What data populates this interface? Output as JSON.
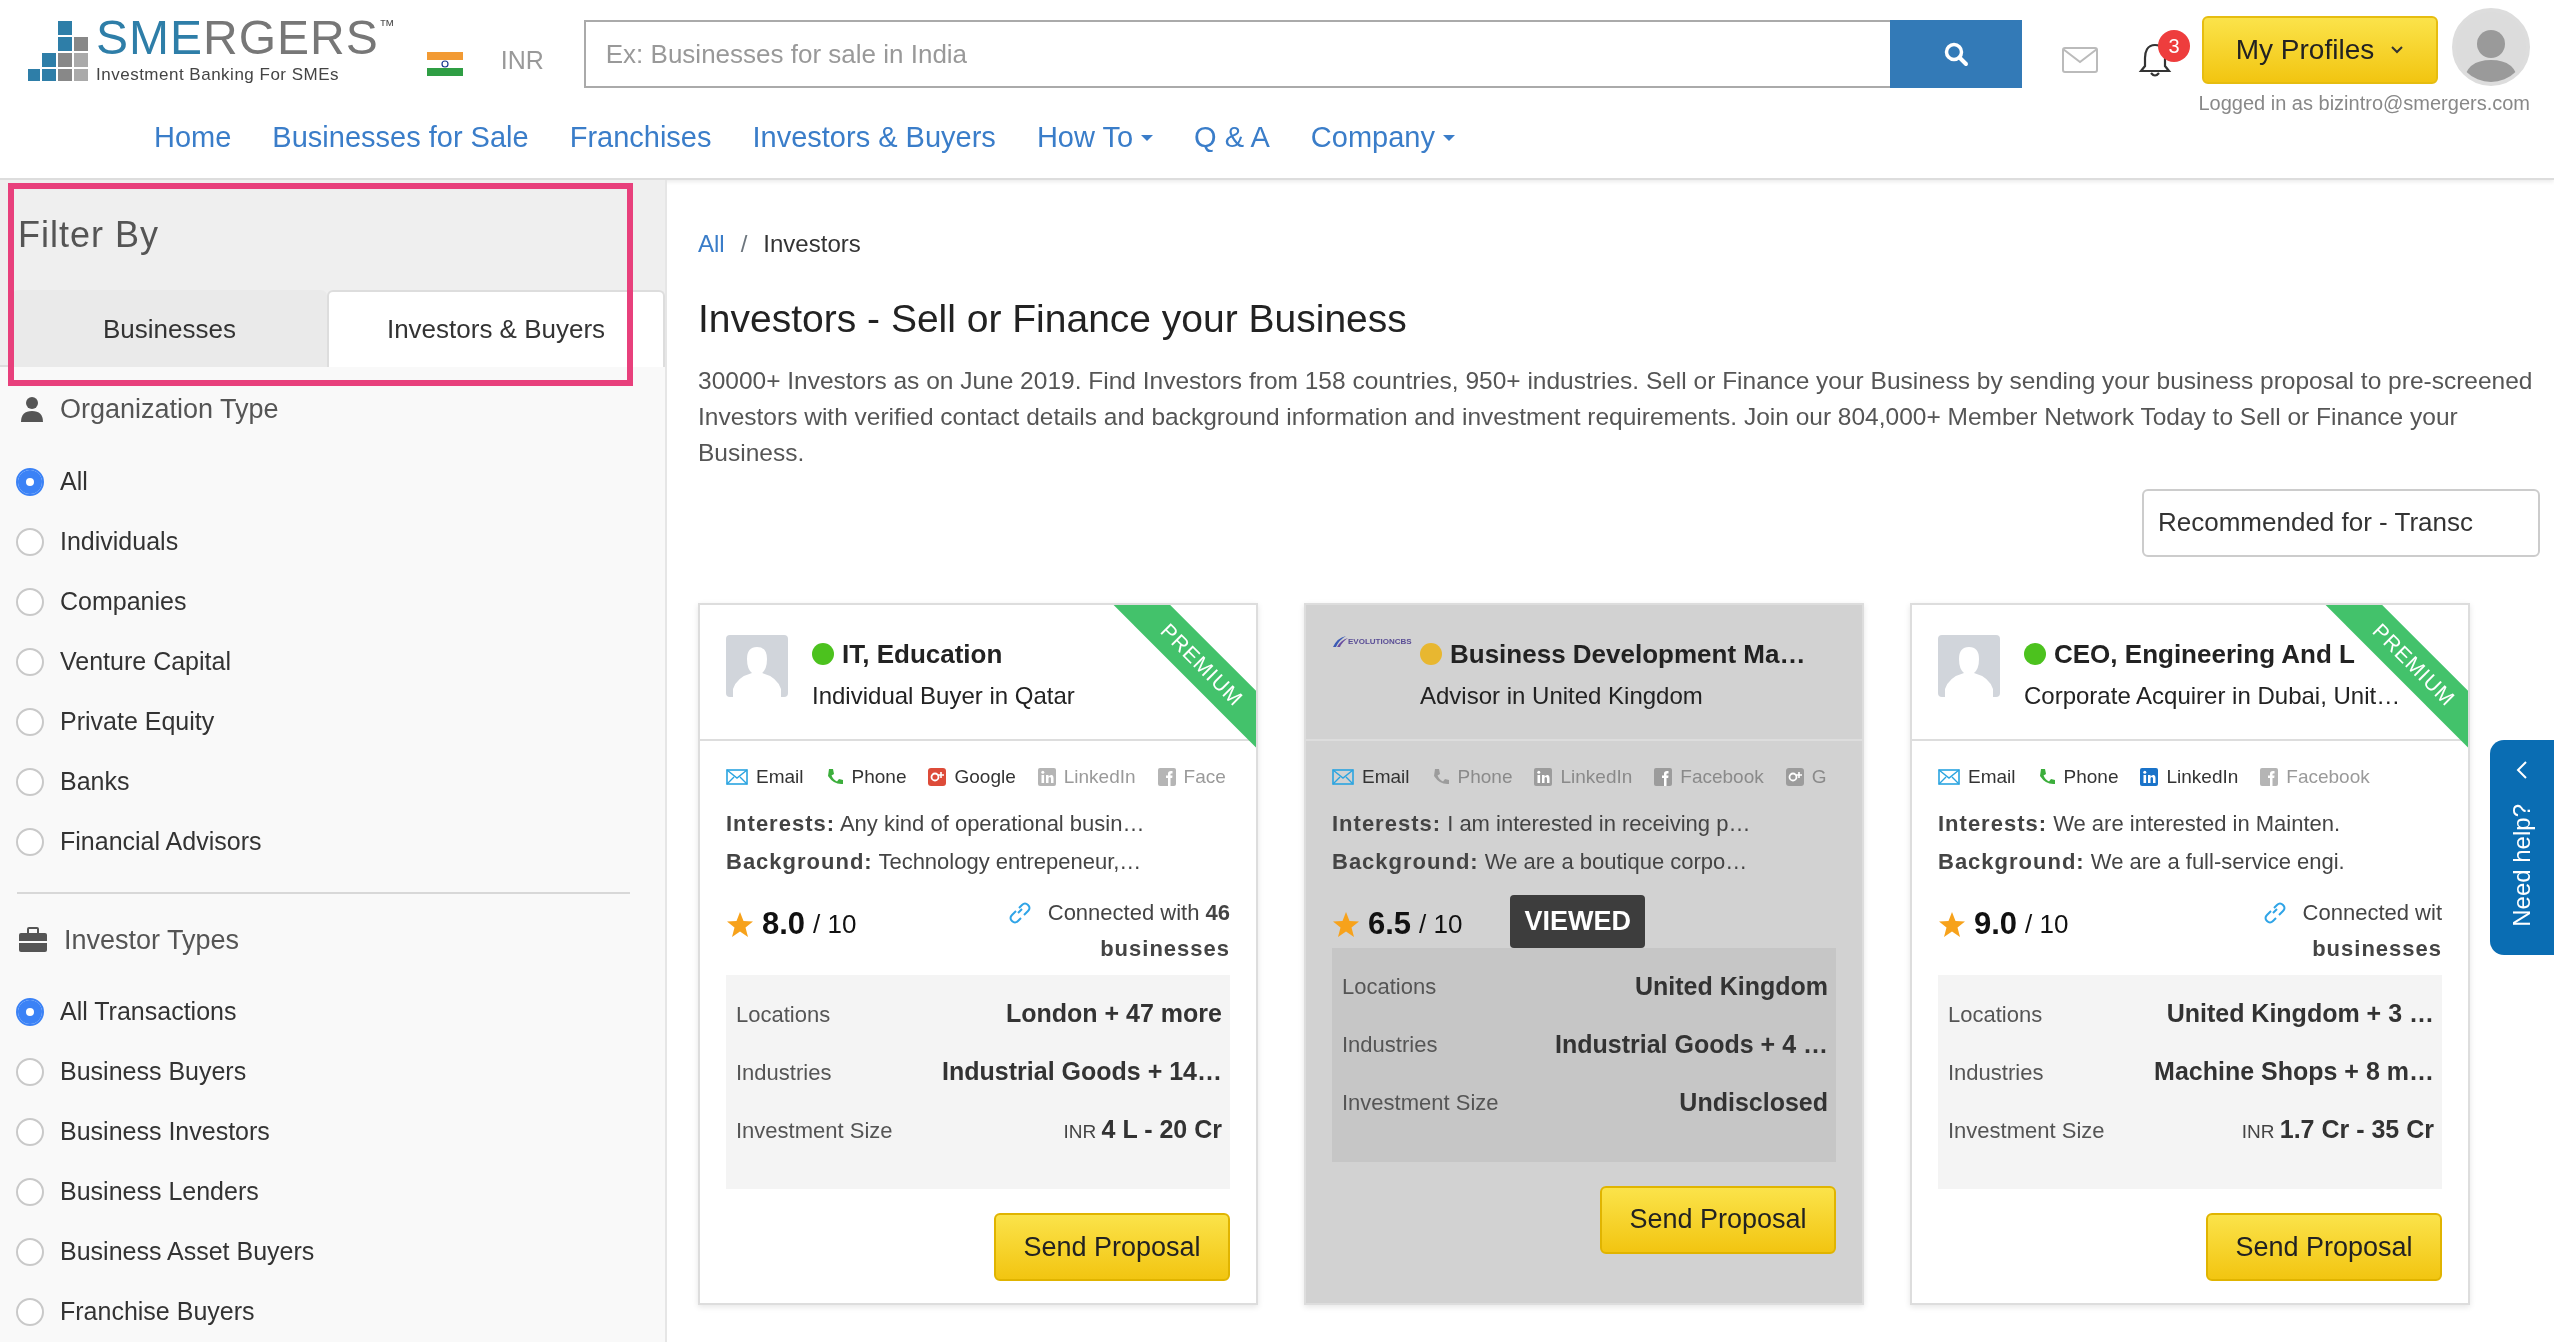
{
  "header": {
    "logo_primary": "SME",
    "logo_secondary": "RGERS",
    "logo_tm": "™",
    "logo_tagline": "Investment Banking For SMEs",
    "currency": "INR",
    "search": {
      "placeholder": "Ex: Businesses for sale in India"
    },
    "notifications": "3",
    "profile_button": "My Profiles",
    "logged_in": "Logged in as bizintro@smergers.com"
  },
  "nav": [
    {
      "label": "Home",
      "dropdown": false
    },
    {
      "label": "Businesses for Sale",
      "dropdown": false
    },
    {
      "label": "Franchises",
      "dropdown": false
    },
    {
      "label": "Investors & Buyers",
      "dropdown": false
    },
    {
      "label": "How To",
      "dropdown": true
    },
    {
      "label": "Q & A",
      "dropdown": false
    },
    {
      "label": "Company",
      "dropdown": true
    }
  ],
  "sidebar": {
    "title": "Filter By",
    "tabs": [
      {
        "label": "Businesses",
        "selected": false
      },
      {
        "label": "Investors & Buyers",
        "selected": true
      }
    ],
    "groups": [
      {
        "kind": "person",
        "title": "Organization Type",
        "options": [
          {
            "label": "All",
            "selected": true
          },
          {
            "label": "Individuals",
            "selected": false
          },
          {
            "label": "Companies",
            "selected": false
          },
          {
            "label": "Venture Capital",
            "selected": false
          },
          {
            "label": "Private Equity",
            "selected": false
          },
          {
            "label": "Banks",
            "selected": false
          },
          {
            "label": "Financial Advisors",
            "selected": false
          }
        ]
      },
      {
        "kind": "briefcase",
        "title": "Investor Types",
        "options": [
          {
            "label": "All Transactions",
            "selected": true
          },
          {
            "label": "Business Buyers",
            "selected": false
          },
          {
            "label": "Business Investors",
            "selected": false
          },
          {
            "label": "Business Lenders",
            "selected": false
          },
          {
            "label": "Business Asset Buyers",
            "selected": false
          },
          {
            "label": "Franchise Buyers",
            "selected": false
          }
        ]
      }
    ]
  },
  "breadcrumb": {
    "items": [
      {
        "label": "All",
        "link": true
      },
      {
        "label": "Investors",
        "link": false
      }
    ],
    "separator": "/"
  },
  "title": "Investors - Sell or Finance your Business",
  "description": "30000+ Investors as on June 2019. Find Investors from 158 countries, 950+ industries. Sell or Finance your Business by sending your business proposal to pre-screened Investors with verified contact details and background information and investment requirements. Join our 804,000+ Member Network Today to Sell or Finance your Business.",
  "sort": "Recommended for - Transc",
  "cards": [
    {
      "premium": true,
      "premium_label": "PREMIUM",
      "viewed": false,
      "kind": "person",
      "color": "#4cc21e",
      "title": "IT, Education",
      "subtitle": "Individual Buyer in Qatar",
      "contacts": [
        {
          "kind": "email",
          "label": "Email",
          "enabled": true
        },
        {
          "kind": "phone",
          "label": "Phone",
          "enabled": true
        },
        {
          "kind": "google",
          "label": "Google",
          "enabled": true
        },
        {
          "kind": "linkedin",
          "label": "LinkedIn",
          "enabled": false
        },
        {
          "kind": "facebook",
          "label": "Face",
          "enabled": false
        }
      ],
      "interests_label": "Interests:",
      "interests": "Any kind of operational busin…",
      "background_label": "Background:",
      "background": "Technology entrepeneur,…",
      "rating": "8.0",
      "rating_max": "/ 10",
      "connected": {
        "text": "Connected with",
        "count": "46",
        "unit": "businesses"
      },
      "details": [
        {
          "label": "Locations",
          "value": "London + 47 more"
        },
        {
          "label": "Industries",
          "value": "Industrial Goods + 14…"
        },
        {
          "label": "Investment Size",
          "currency": "INR",
          "value": "4 L - 20 Cr"
        }
      ],
      "button": "Send Proposal"
    },
    {
      "premium": false,
      "viewed": true,
      "badge": "VIEWED",
      "kind": "company",
      "logo_text": "EVOLUTIONCBS",
      "color": "#e8b730",
      "title": "Business Development Ma…",
      "subtitle": "Advisor in United Kingdom",
      "contacts": [
        {
          "kind": "email",
          "label": "Email",
          "enabled": true
        },
        {
          "kind": "phone",
          "label": "Phone",
          "enabled": false
        },
        {
          "kind": "linkedin",
          "label": "LinkedIn",
          "enabled": false
        },
        {
          "kind": "facebook",
          "label": "Facebook",
          "enabled": false
        },
        {
          "kind": "google",
          "label": "G",
          "enabled": false
        }
      ],
      "interests_label": "Interests:",
      "interests": "I am interested in receiving p…",
      "background_label": "Background:",
      "background": "We are a boutique corpo…",
      "rating": "6.5",
      "rating_max": "/ 10",
      "details": [
        {
          "label": "Locations",
          "value": "United Kingdom"
        },
        {
          "label": "Industries",
          "value": "Industrial Goods + 4 …"
        },
        {
          "label": "Investment Size",
          "value": "Undisclosed"
        }
      ],
      "button": "Send Proposal"
    },
    {
      "premium": true,
      "premium_label": "PREMIUM",
      "viewed": false,
      "kind": "person",
      "color": "#4cc21e",
      "title": "CEO, Engineering And L",
      "subtitle": "Corporate Acquirer in Dubai, Unit…",
      "contacts": [
        {
          "kind": "email",
          "label": "Email",
          "enabled": true
        },
        {
          "kind": "phone",
          "label": "Phone",
          "enabled": true
        },
        {
          "kind": "linkedin",
          "label": "LinkedIn",
          "enabled": true
        },
        {
          "kind": "facebook",
          "label": "Facebook",
          "enabled": false
        }
      ],
      "interests_label": "Interests:",
      "interests": "We are interested in Mainten.",
      "background_label": "Background:",
      "background": "We are a full-service engi.",
      "rating": "9.0",
      "rating_max": "/ 10",
      "connected": {
        "text": "Connected wit",
        "unit": "businesses"
      },
      "details": [
        {
          "label": "Locations",
          "value": "United Kingdom + 3 …"
        },
        {
          "label": "Industries",
          "value": "Machine Shops + 8 m…"
        },
        {
          "label": "Investment Size",
          "currency": "INR",
          "value": "1.7 Cr - 35 Cr"
        }
      ],
      "button": "Send Proposal"
    }
  ],
  "help_tab": "Need help?"
}
